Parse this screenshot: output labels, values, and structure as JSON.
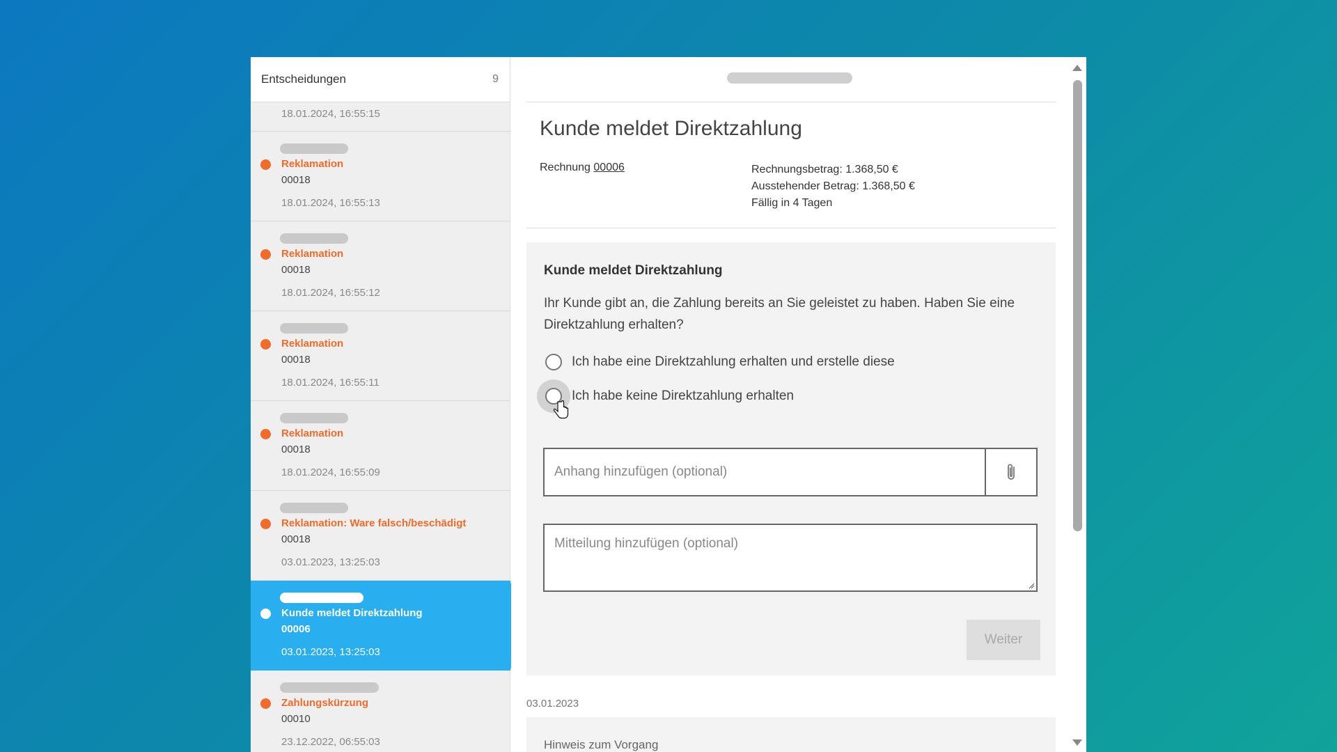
{
  "sidebar": {
    "title": "Entscheidungen",
    "count": "9",
    "top_timestamp": "18.01.2024, 16:55:15",
    "items": [
      {
        "type": "Reklamation",
        "number": "00018",
        "timestamp": "18.01.2024, 16:55:13"
      },
      {
        "type": "Reklamation",
        "number": "00018",
        "timestamp": "18.01.2024, 16:55:12"
      },
      {
        "type": "Reklamation",
        "number": "00018",
        "timestamp": "18.01.2024, 16:55:11"
      },
      {
        "type": "Reklamation",
        "number": "00018",
        "timestamp": "18.01.2024, 16:55:09"
      },
      {
        "type": "Reklamation: Ware falsch/beschädigt",
        "number": "00018",
        "timestamp": "03.01.2023, 13:25:03"
      },
      {
        "type": "Kunde meldet Direktzahlung",
        "number": "00006",
        "timestamp": "03.01.2023, 13:25:03"
      },
      {
        "type": "Zahlungskürzung",
        "number": "00010",
        "timestamp": "23.12.2022, 06:55:03"
      }
    ]
  },
  "detail": {
    "title": "Kunde meldet Direktzahlung",
    "invoice_label": "Rechnung",
    "invoice_number": "00006",
    "amount": "Rechnungsbetrag: 1.368,50 €",
    "outstanding": "Ausstehender Betrag: 1.368,50 €",
    "due": "Fällig in 4 Tagen"
  },
  "decision": {
    "title": "Kunde meldet Direktzahlung",
    "text": "Ihr Kunde gibt an, die Zahlung bereits an Sie geleistet zu haben. Haben Sie eine Direktzahlung erhalten?",
    "option_yes": "Ich habe eine Direktzahlung erhalten und erstelle diese",
    "option_no": "Ich habe keine Direktzahlung erhalten",
    "attachment_placeholder": "Anhang hinzufügen (optional)",
    "message_placeholder": "Mitteilung hinzufügen (optional)",
    "submit_label": "Weiter"
  },
  "history": {
    "date": "03.01.2023",
    "note_label": "Hinweis zum Vorgang"
  },
  "colors": {
    "accent": "#29aef0",
    "status_orange": "#f26b2a"
  }
}
